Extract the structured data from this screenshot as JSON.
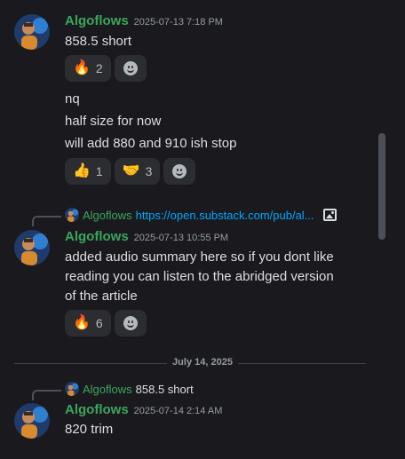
{
  "messages": [
    {
      "author": "Algoflows",
      "time": "2025-07-13 7:18 PM",
      "lines": [
        "858.5 short"
      ],
      "reactions": [
        {
          "emoji": "🔥",
          "count": "2"
        }
      ]
    },
    {
      "lines": [
        "nq",
        "half size for now",
        "will add 880 and 910 ish stop"
      ],
      "reactions": [
        {
          "emoji": "👍",
          "count": "1"
        },
        {
          "emoji": "🤝",
          "count": "3"
        }
      ]
    },
    {
      "reply": {
        "author": "Algoflows",
        "text": "https://open.substack.com/pub/al..."
      },
      "author": "Algoflows",
      "time": "2025-07-13 10:55 PM",
      "lines": [
        "added audio summary here so if you dont like",
        "reading you can listen to the abridged version",
        "of the article"
      ],
      "reactions": [
        {
          "emoji": "🔥",
          "count": "6"
        }
      ]
    },
    {
      "reply": {
        "author": "Algoflows",
        "text": "858.5 short"
      },
      "author": "Algoflows",
      "time": "2025-07-14 2:14 AM",
      "lines": [
        "820 trim"
      ]
    }
  ],
  "date_divider": "July 14, 2025",
  "icons": {
    "add_reaction": "smiley-add-reaction-icon",
    "image_attachment": "image-icon"
  },
  "colors": {
    "background": "#1a1a1e",
    "author": "#3ba55d",
    "link": "#00a8fc",
    "muted": "#949ba4"
  }
}
